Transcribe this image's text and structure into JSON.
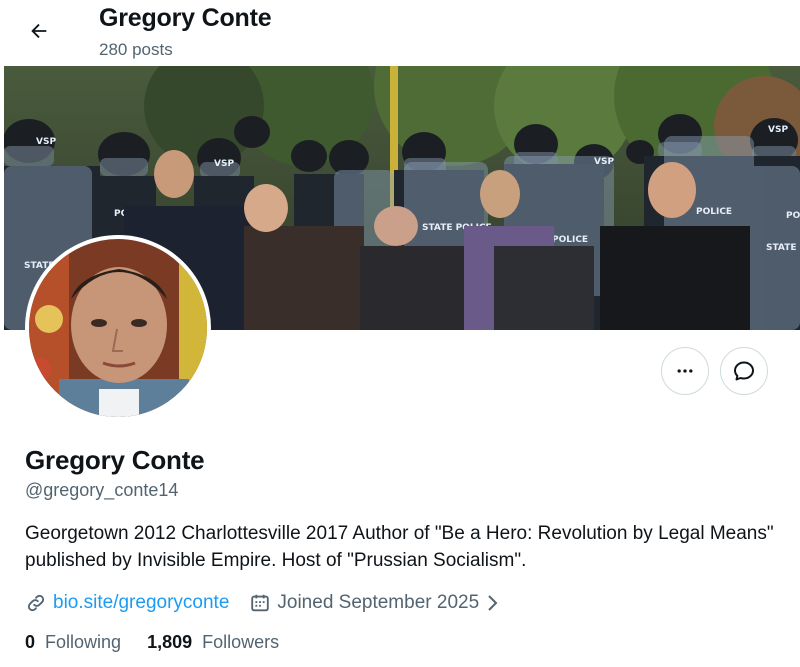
{
  "header": {
    "title": "Gregory Conte",
    "posts": "280 posts"
  },
  "profile": {
    "display_name": "Gregory Conte",
    "handle": "@gregory_conte14",
    "bio": "Georgetown 2012 Charlottesville 2017 Author of \"Be a Hero: Revolution by Legal Means\" published by Invisible Empire. Host of \"Prussian Socialism\".",
    "link": "bio.site/gregoryconte",
    "joined": "Joined September 2025",
    "following_count": "0",
    "following_label": "Following",
    "followers_count": "1,809",
    "followers_label": "Followers"
  },
  "banner": {
    "shield_labels": [
      "VSP",
      "VSP",
      "VSP",
      "VSP",
      "POLICE",
      "POLICE",
      "STATE",
      "STATE POLICE",
      "POLICE",
      "STATE",
      "PO"
    ]
  },
  "icons": {
    "back": "arrow-left-icon",
    "more": "more-horizontal-icon",
    "message": "message-bubble-icon",
    "link": "link-icon",
    "calendar": "calendar-icon",
    "chevron": "chevron-right-icon"
  },
  "colors": {
    "accent": "#1d9bf0",
    "secondary_text": "#536471",
    "primary_text": "#0f1419",
    "border": "#cfd9de"
  }
}
